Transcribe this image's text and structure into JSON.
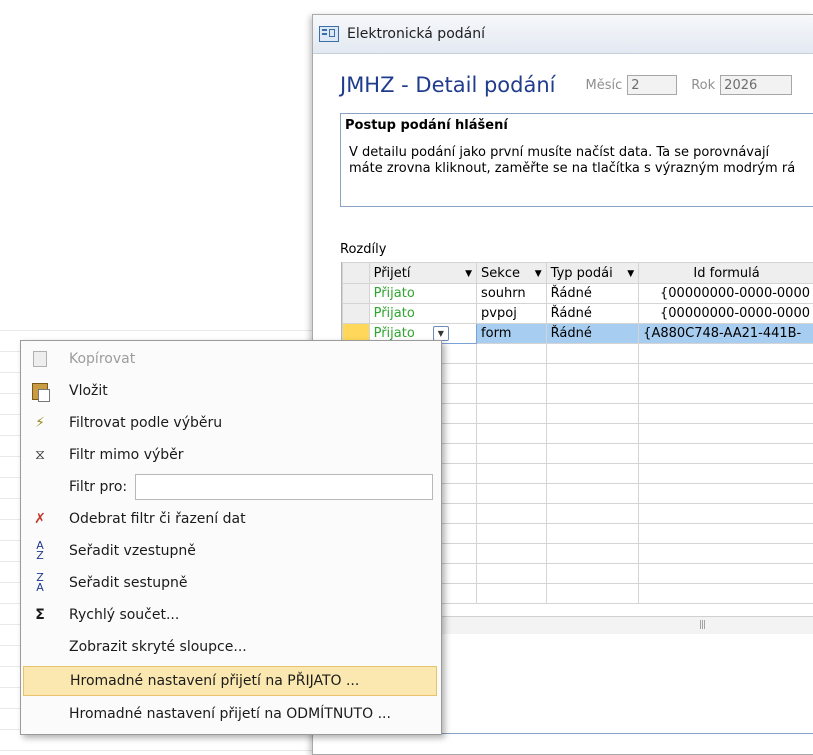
{
  "window": {
    "title": "Elektronická podání"
  },
  "form": {
    "title": "JMHZ - Detail podání",
    "month_label": "Měsíc",
    "month_value": "2",
    "year_label": "Rok",
    "year_value": "2026"
  },
  "info": {
    "heading": "Postup podání hlášení",
    "line1": "V detailu podání jako první musíte načíst data. Ta se porovnávají",
    "line2": "máte zrovna kliknout, zaměřte se na tlačítka s výrazným modrým rá"
  },
  "rozdily": {
    "label": "Rozdíly"
  },
  "grid": {
    "columns": [
      "Přijetí",
      "Sekce",
      "Typ podái",
      "Id formulá"
    ],
    "rows": [
      {
        "prijeti": "Přijato",
        "sekce": "souhrn",
        "typ": "Řádné",
        "id": "{00000000-0000-0000"
      },
      {
        "prijeti": "Přijato",
        "sekce": "pvpoj",
        "typ": "Řádné",
        "id": "{00000000-0000-0000"
      },
      {
        "prijeti": "Přijato",
        "sekce": "form",
        "typ": "Řádné",
        "id": "{A880C748-AA21-441B-"
      }
    ]
  },
  "menu": {
    "copy": "Kopírovat",
    "paste": "Vložit",
    "filter_by_selection": "Filtrovat podle výběru",
    "filter_excluding": "Filtr mimo výběr",
    "filter_for": "Filtr pro:",
    "remove_filter": "Odebrat filtr či řazení dat",
    "sort_asc": "Seřadit vzestupně",
    "sort_desc": "Seřadit sestupně",
    "quick_sum": "Rychlý součet...",
    "show_hidden": "Zobrazit skryté sloupce...",
    "bulk_accept": "Hromadné nastavení přijetí na PŘIJATO ...",
    "bulk_reject": "Hromadné nastavení přijetí na ODMÍTNUTO ..."
  },
  "colors": {
    "title_blue": "#1f3c8d",
    "accepted_green": "#2ea52e",
    "header_highlight": "#ffd75a",
    "menu_highlight": "#fbe8b0"
  }
}
